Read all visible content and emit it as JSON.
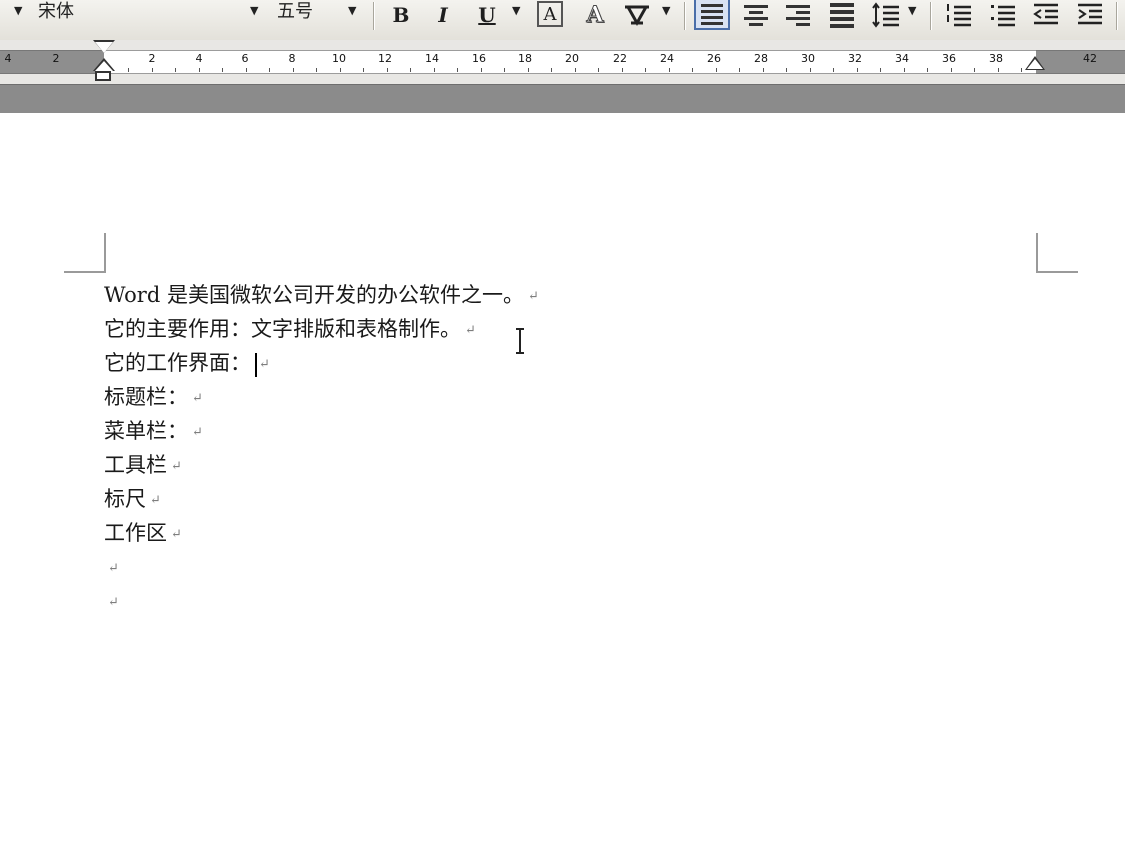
{
  "toolbar": {
    "font_name": "宋体",
    "font_size": "五号",
    "bold_label": "B",
    "italic_label": "I",
    "underline_label": "U",
    "char_border_label": "A",
    "char_shading_label": "A",
    "tools": [
      "font-name-combo",
      "font-size-combo",
      "bold-button",
      "italic-button",
      "underline-button",
      "char-border-button",
      "char-shading-button",
      "char-scale-button",
      "align-justify-button",
      "align-center-button",
      "align-right-button",
      "align-distributed-button",
      "line-spacing-button",
      "numbering-button",
      "bullets-button",
      "decrease-indent-button",
      "increase-indent-button"
    ]
  },
  "ruler": {
    "labels": [
      "4",
      "2",
      "2",
      "4",
      "6",
      "8",
      "10",
      "12",
      "14",
      "16",
      "18",
      "20",
      "22",
      "24",
      "26",
      "28",
      "30",
      "32",
      "34",
      "36",
      "38",
      "42"
    ]
  },
  "document": {
    "lines": [
      "Word 是美国微软公司开发的办公软件之一。",
      "它的主要作用：文字排版和表格制作。",
      "它的工作界面：",
      "标题栏：",
      "菜单栏：",
      "工具栏",
      "标尺",
      "工作区",
      "",
      ""
    ],
    "paragraph_mark": "↵",
    "cursor_line": 2
  },
  "colors": {
    "toolbar_bg": "#e9e7e0",
    "ruler_margin": "#8e8e8e",
    "gray_band": "#8b8b8b",
    "page_bg": "#ffffff",
    "text": "#1a1a1a"
  }
}
